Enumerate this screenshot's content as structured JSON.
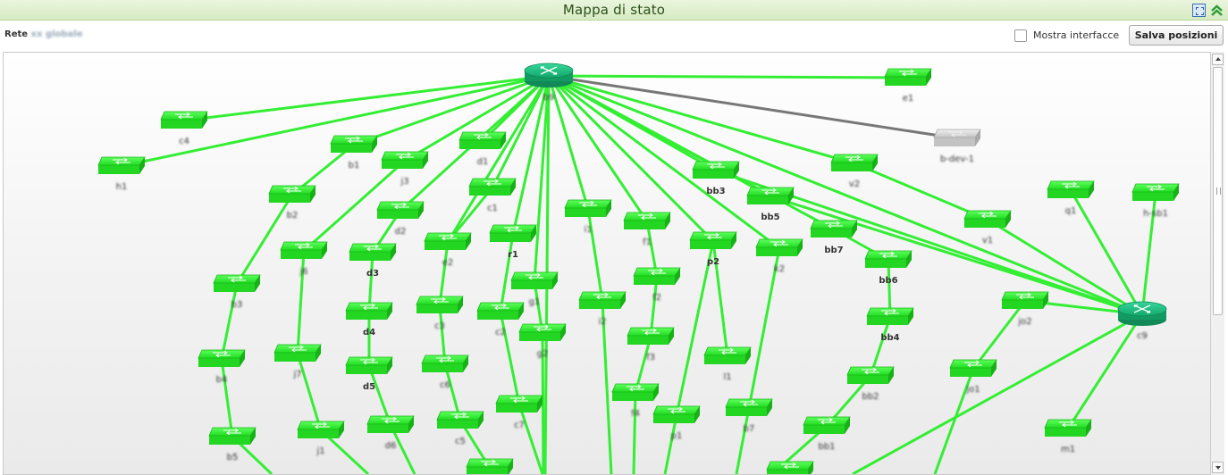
{
  "window": {
    "title": "Mappa di stato"
  },
  "toolbar": {
    "network_prefix": "Rete",
    "network_name": "xx globale",
    "show_interfaces_label": "Mostra interfacce",
    "show_interfaces_checked": false,
    "save_positions_label": "Salva posizioni"
  },
  "colors": {
    "link_up": "#33ee33",
    "link_down": "#777777",
    "node_up": "#22dd22",
    "node_down": "#cfcfcf",
    "router": "#1fbf7f"
  },
  "map": {
    "nodes": [
      {
        "id": "r0",
        "type": "router",
        "label": "b9",
        "blur": true,
        "status": "up"
      },
      {
        "id": "r1",
        "type": "router",
        "label": "c9",
        "blur": true,
        "status": "up"
      },
      {
        "id": "s_e1",
        "type": "switch",
        "label": "e1",
        "blur": true,
        "status": "up"
      },
      {
        "id": "s_bdev",
        "type": "switch",
        "label": "b-dev-1",
        "blur": true,
        "status": "down"
      },
      {
        "id": "s_c4",
        "type": "switch",
        "label": "c4",
        "blur": true,
        "status": "up"
      },
      {
        "id": "s_h1",
        "type": "switch",
        "label": "h1",
        "blur": true,
        "status": "up"
      },
      {
        "id": "s_b1",
        "type": "switch",
        "label": "b1",
        "blur": true,
        "status": "up"
      },
      {
        "id": "s_d1",
        "type": "switch",
        "label": "d1",
        "blur": true,
        "status": "up"
      },
      {
        "id": "s_j3",
        "type": "switch",
        "label": "j3",
        "blur": true,
        "status": "up"
      },
      {
        "id": "s_c1",
        "type": "switch",
        "label": "c1",
        "blur": true,
        "status": "up"
      },
      {
        "id": "s_b2",
        "type": "switch",
        "label": "b2",
        "blur": true,
        "status": "up"
      },
      {
        "id": "s_d2",
        "type": "switch",
        "label": "d2",
        "blur": true,
        "status": "up"
      },
      {
        "id": "s_i1",
        "type": "switch",
        "label": "i1",
        "blur": true,
        "status": "up"
      },
      {
        "id": "s_f1",
        "type": "switch",
        "label": "f1",
        "blur": true,
        "status": "up"
      },
      {
        "id": "s_bb3",
        "type": "switch",
        "label": "bb3",
        "blur": false,
        "status": "up"
      },
      {
        "id": "s_bb5",
        "type": "switch",
        "label": "bb5",
        "blur": false,
        "status": "up"
      },
      {
        "id": "s_bb7",
        "type": "switch",
        "label": "bb7",
        "blur": false,
        "status": "up"
      },
      {
        "id": "s_v2",
        "type": "switch",
        "label": "v2",
        "blur": true,
        "status": "up"
      },
      {
        "id": "s_v1",
        "type": "switch",
        "label": "v1",
        "blur": true,
        "status": "up"
      },
      {
        "id": "s_q1",
        "type": "switch",
        "label": "q1",
        "blur": true,
        "status": "up"
      },
      {
        "id": "s_hb1",
        "type": "switch",
        "label": "h-sb1",
        "blur": true,
        "status": "up"
      },
      {
        "id": "s_p2",
        "type": "switch",
        "label": "p2",
        "blur": false,
        "status": "up"
      },
      {
        "id": "s_k2",
        "type": "switch",
        "label": "k2",
        "blur": true,
        "status": "up"
      },
      {
        "id": "s_bb6",
        "type": "switch",
        "label": "bb6",
        "blur": false,
        "status": "up"
      },
      {
        "id": "s_e2",
        "type": "switch",
        "label": "e2",
        "blur": true,
        "status": "up"
      },
      {
        "id": "s_r1",
        "type": "switch",
        "label": "r1",
        "blur": false,
        "status": "up"
      },
      {
        "id": "s_j6",
        "type": "switch",
        "label": "j6",
        "blur": true,
        "status": "up"
      },
      {
        "id": "s_b3",
        "type": "switch",
        "label": "b3",
        "blur": true,
        "status": "up"
      },
      {
        "id": "s_d3",
        "type": "switch",
        "label": "d3",
        "blur": false,
        "status": "up"
      },
      {
        "id": "s_g1",
        "type": "switch",
        "label": "g1",
        "blur": true,
        "status": "up"
      },
      {
        "id": "s_f2",
        "type": "switch",
        "label": "f2",
        "blur": true,
        "status": "up"
      },
      {
        "id": "s_i2",
        "type": "switch",
        "label": "i2",
        "blur": true,
        "status": "up"
      },
      {
        "id": "s_c3",
        "type": "switch",
        "label": "c3",
        "blur": true,
        "status": "up"
      },
      {
        "id": "s_c2",
        "type": "switch",
        "label": "c2",
        "blur": true,
        "status": "up"
      },
      {
        "id": "s_d4",
        "type": "switch",
        "label": "d4",
        "blur": false,
        "status": "up"
      },
      {
        "id": "s_bb4",
        "type": "switch",
        "label": "bb4",
        "blur": false,
        "status": "up"
      },
      {
        "id": "s_jo2",
        "type": "switch",
        "label": "jo2",
        "blur": true,
        "status": "up"
      },
      {
        "id": "s_g2",
        "type": "switch",
        "label": "g2",
        "blur": true,
        "status": "up"
      },
      {
        "id": "s_f3",
        "type": "switch",
        "label": "f3",
        "blur": true,
        "status": "up"
      },
      {
        "id": "s_l1",
        "type": "switch",
        "label": "l1",
        "blur": true,
        "status": "up"
      },
      {
        "id": "s_b4",
        "type": "switch",
        "label": "b4",
        "blur": true,
        "status": "up"
      },
      {
        "id": "s_j7",
        "type": "switch",
        "label": "j7",
        "blur": true,
        "status": "up"
      },
      {
        "id": "s_d5",
        "type": "switch",
        "label": "d5",
        "blur": false,
        "status": "up"
      },
      {
        "id": "s_c6",
        "type": "switch",
        "label": "c6",
        "blur": true,
        "status": "up"
      },
      {
        "id": "s_bb2",
        "type": "switch",
        "label": "bb2",
        "blur": true,
        "status": "up"
      },
      {
        "id": "s_jo1",
        "type": "switch",
        "label": "jo1",
        "blur": true,
        "status": "up"
      },
      {
        "id": "s_c7",
        "type": "switch",
        "label": "c7",
        "blur": true,
        "status": "up"
      },
      {
        "id": "s_f4",
        "type": "switch",
        "label": "f4",
        "blur": true,
        "status": "up"
      },
      {
        "id": "s_p1",
        "type": "switch",
        "label": "p1",
        "blur": true,
        "status": "up"
      },
      {
        "id": "s_b7",
        "type": "switch",
        "label": "b7",
        "blur": true,
        "status": "up"
      },
      {
        "id": "s_b5",
        "type": "switch",
        "label": "b5",
        "blur": true,
        "status": "up"
      },
      {
        "id": "s_j1",
        "type": "switch",
        "label": "j1",
        "blur": true,
        "status": "up"
      },
      {
        "id": "s_d6",
        "type": "switch",
        "label": "d6",
        "blur": true,
        "status": "up"
      },
      {
        "id": "s_c5",
        "type": "switch",
        "label": "c5",
        "blur": true,
        "status": "up"
      },
      {
        "id": "s_bb1",
        "type": "switch",
        "label": "bb1",
        "blur": true,
        "status": "up"
      },
      {
        "id": "s_m1",
        "type": "switch",
        "label": "m1",
        "blur": true,
        "status": "up"
      },
      {
        "id": "s_c8",
        "type": "switch",
        "label": "c8",
        "blur": true,
        "status": "up"
      },
      {
        "id": "s_bb0",
        "type": "switch",
        "label": "",
        "blur": true,
        "status": "up"
      }
    ]
  }
}
